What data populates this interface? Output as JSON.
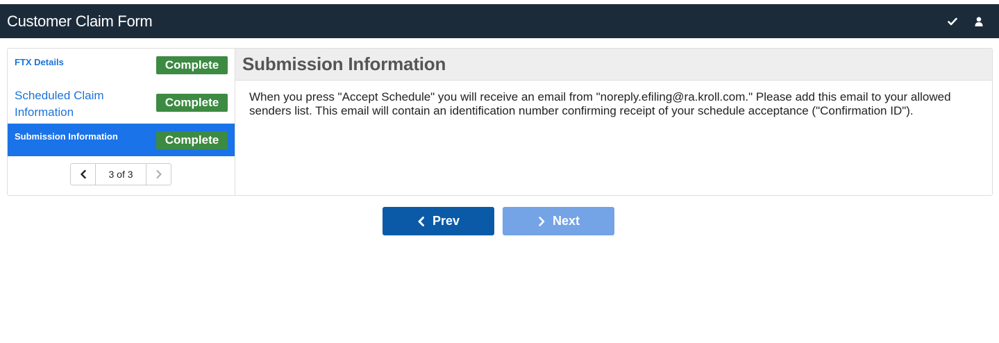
{
  "header": {
    "title": "Customer Claim Form",
    "icons": [
      "check-icon",
      "user-icon"
    ]
  },
  "sidebar": {
    "items": [
      {
        "label": "FTX Details",
        "status": "Complete",
        "active": false
      },
      {
        "label": "Scheduled Claim Information",
        "status": "Complete",
        "active": false
      },
      {
        "label": "Submission Information",
        "status": "Complete",
        "active": true
      }
    ],
    "pager": {
      "text": "3 of 3"
    }
  },
  "main": {
    "heading": "Submission Information",
    "body": "When you press \"Accept Schedule\" you will receive an email from \"noreply.efiling@ra.kroll.com.\" Please add this email to your allowed senders list. This email will contain an identification number confirming receipt of your schedule acceptance (\"Confirmation ID\")."
  },
  "footer": {
    "prev_label": "Prev",
    "next_label": "Next"
  },
  "colors": {
    "topbar": "#1c2b3a",
    "badge": "#3d8a43",
    "active": "#1a73e8",
    "prev": "#0a5aa8",
    "next": "#74a3e6"
  }
}
